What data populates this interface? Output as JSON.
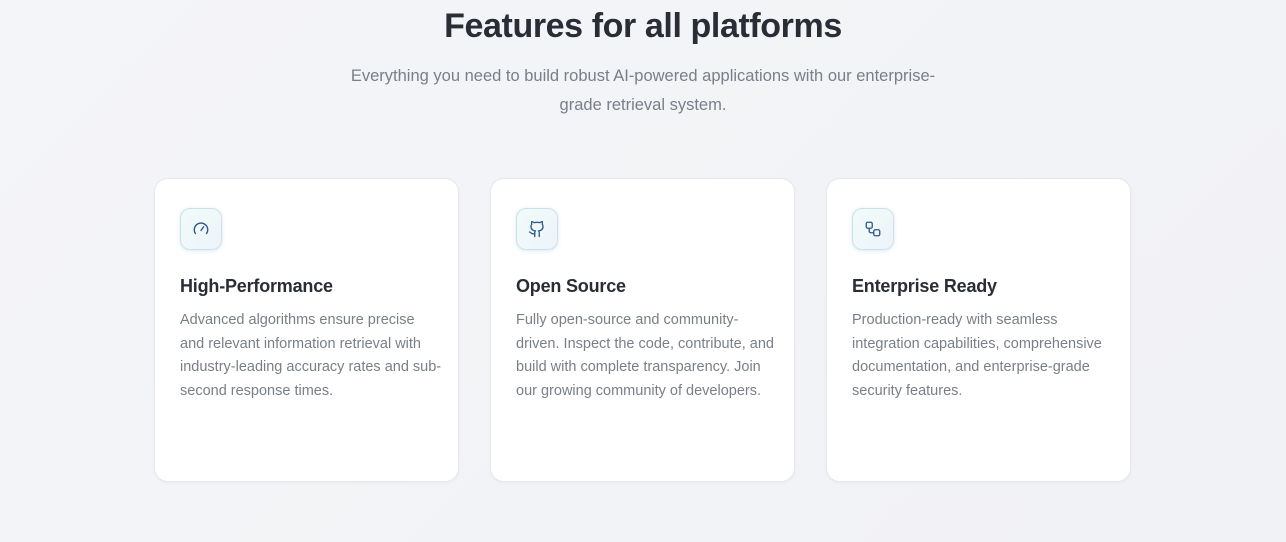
{
  "section": {
    "title": "Features for all platforms",
    "subtitle": "Everything you need to build robust AI-powered applications with our enterprise-grade retrieval system."
  },
  "features": [
    {
      "icon": "gauge-icon",
      "title": "High-Performance",
      "description": "Advanced algorithms ensure precise and relevant information retrieval with industry-leading accuracy rates and sub-second response times."
    },
    {
      "icon": "github-icon",
      "title": "Open Source",
      "description": "Fully open-source and community-driven. Inspect the code, contribute, and build with complete transparency. Join our growing community of developers."
    },
    {
      "icon": "workflow-icon",
      "title": "Enterprise Ready",
      "description": "Production-ready with seamless integration capabilities, comprehensive documentation, and enterprise-grade security features."
    }
  ],
  "colors": {
    "heading": "#2a2d36",
    "body_text": "#7a7e88",
    "icon_stroke": "#2f5a8a",
    "card_background": "#ffffff",
    "page_background": "#f3f4f7"
  }
}
